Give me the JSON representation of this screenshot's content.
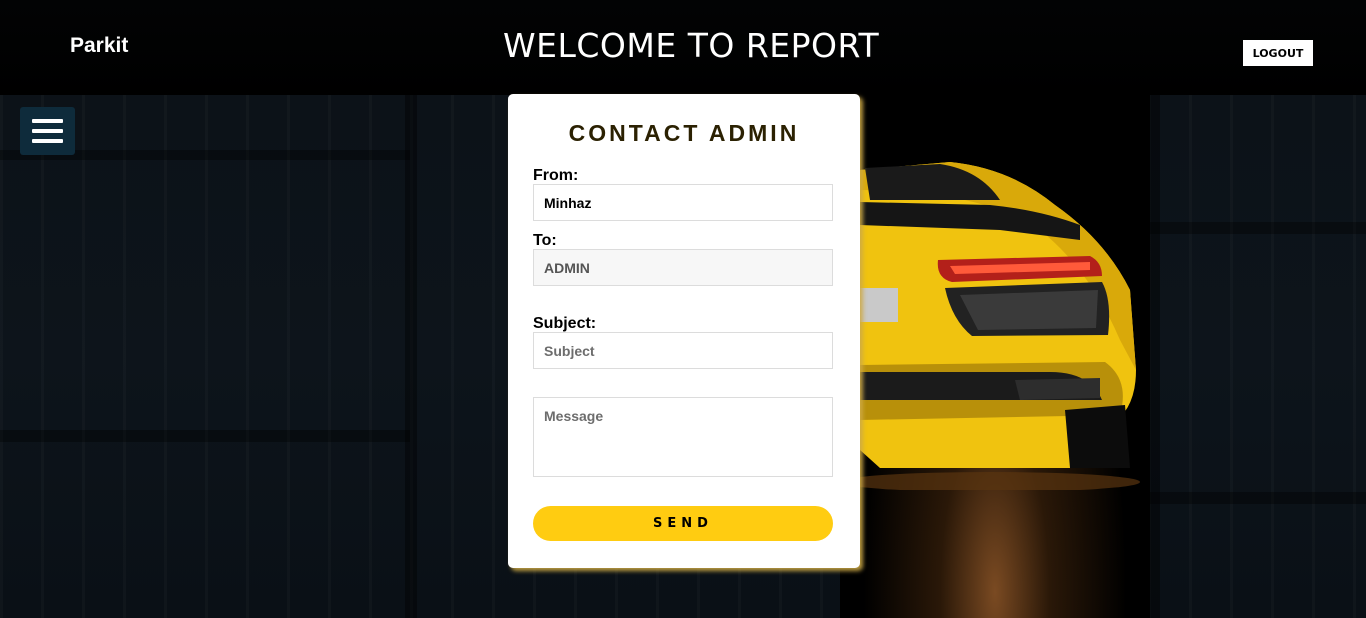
{
  "header": {
    "brand": "Parkit",
    "title": "WELCOME TO REPORT",
    "logout_label": "LOGOUT"
  },
  "form": {
    "title": "CONTACT ADMIN",
    "from_label": "From:",
    "from_value": "Minhaz",
    "to_label": "To:",
    "to_value": "ADMIN",
    "subject_label": "Subject:",
    "subject_placeholder": "Subject",
    "message_placeholder": "Message",
    "send_label": "SEND"
  },
  "icons": {
    "menu": "hamburger-menu-icon"
  },
  "colors": {
    "accent": "#ffcc11",
    "menu_bg": "#0e2b3b",
    "title_text": "#2b2102"
  }
}
